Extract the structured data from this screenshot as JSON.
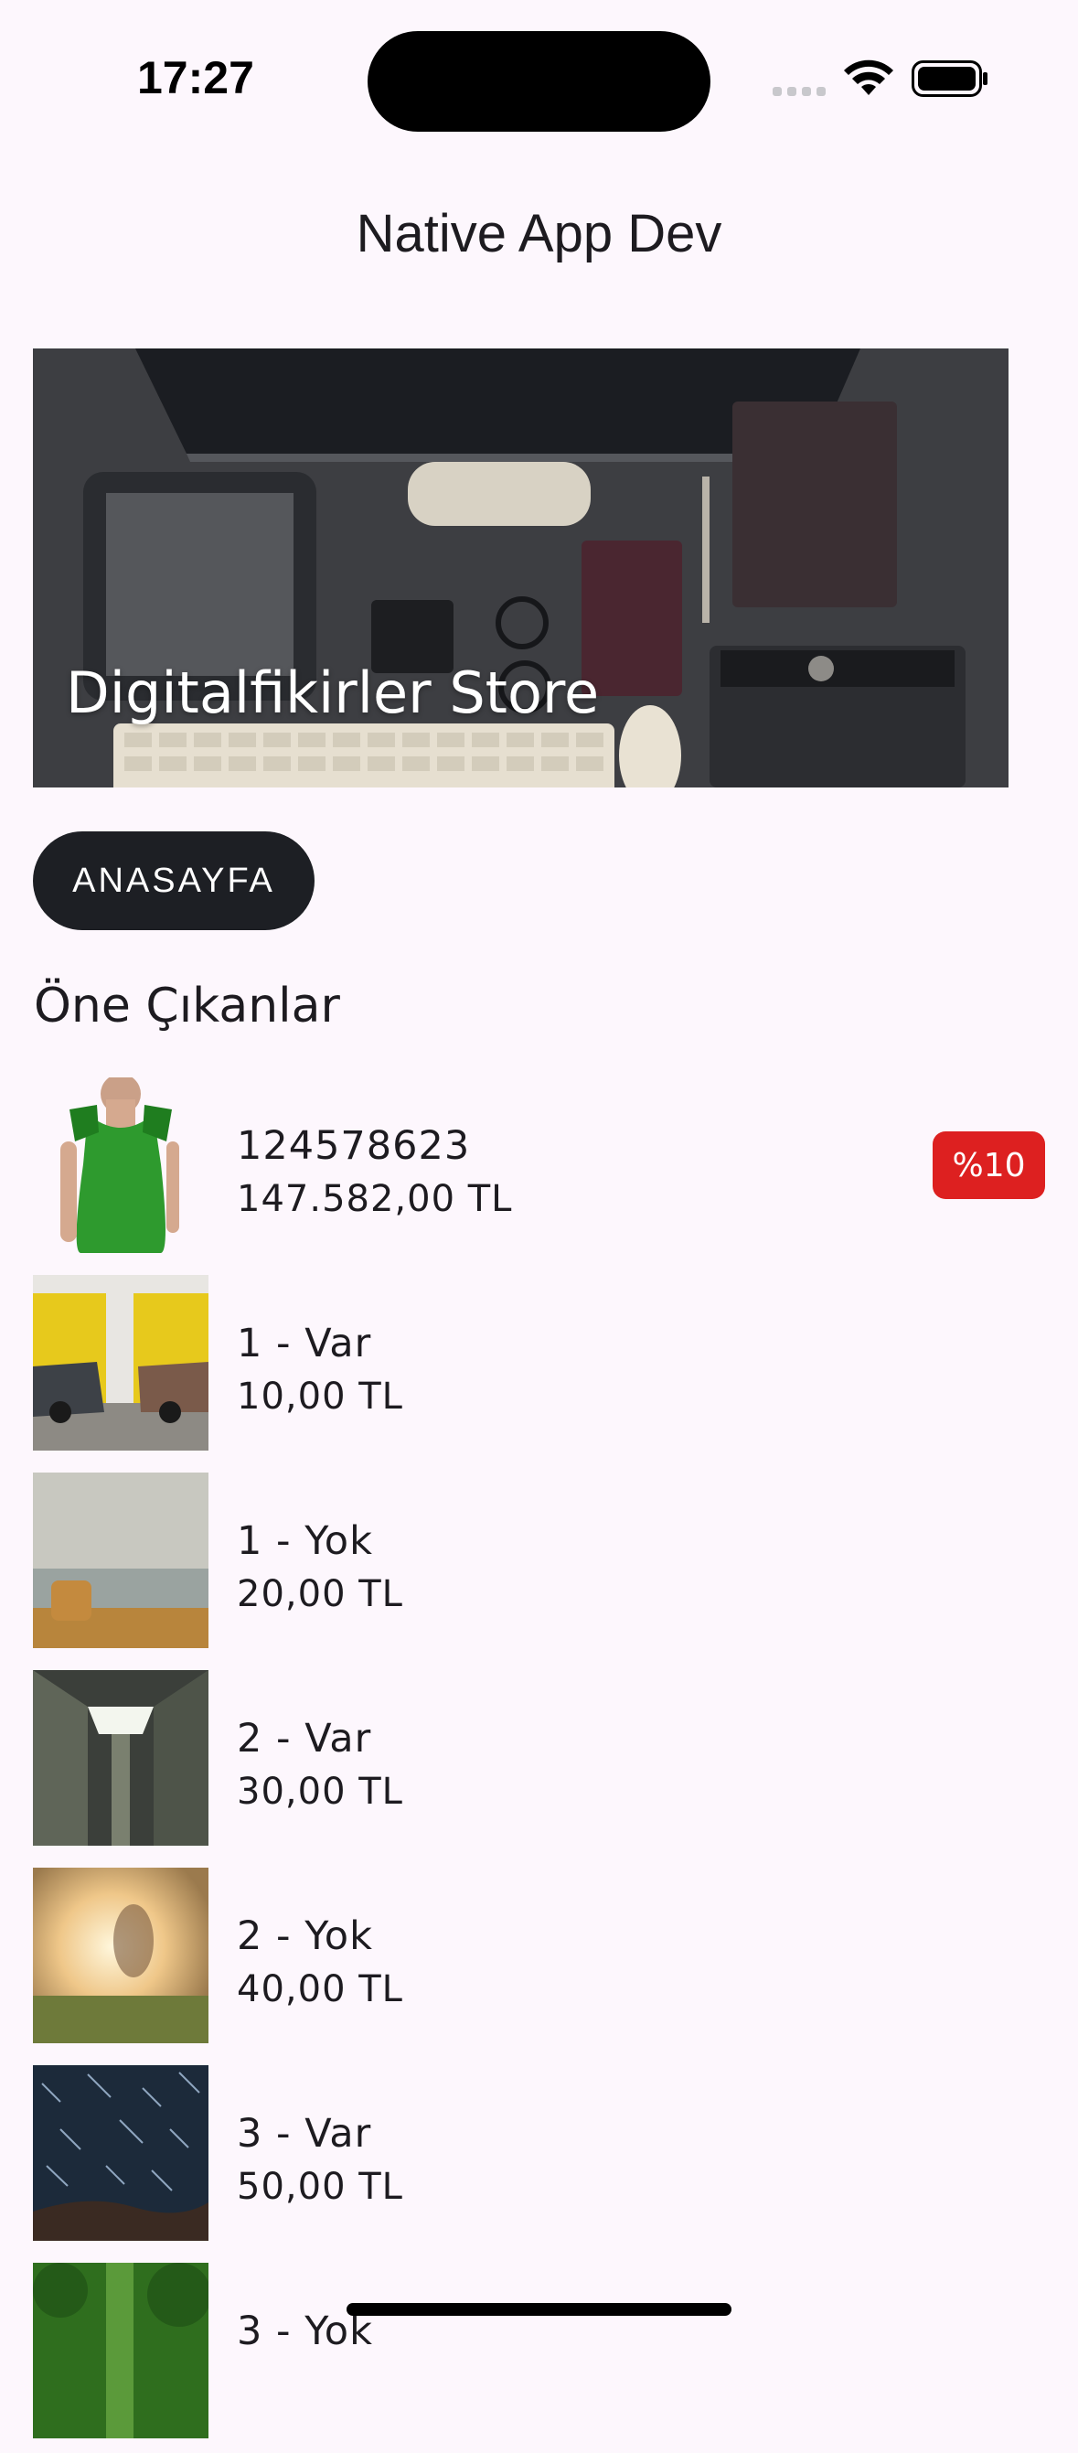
{
  "status_bar": {
    "time": "17:27"
  },
  "header": {
    "title": "Native App Dev"
  },
  "banner": {
    "caption": "Digitalfikirler Store"
  },
  "home_button": {
    "label": "ANASAYFA"
  },
  "section": {
    "title": "Öne Çıkanlar"
  },
  "products": [
    {
      "name": "124578623",
      "price": "147.582,00 TL",
      "badge": "%10",
      "thumb": "green-dress-photo"
    },
    {
      "name": "1 - Var",
      "price": "10,00 TL",
      "thumb": "vintage-cars-photo"
    },
    {
      "name": "1 - Yok",
      "price": "20,00 TL",
      "thumb": "hay-bale-field-photo"
    },
    {
      "name": "2 - Var",
      "price": "30,00 TL",
      "thumb": "building-courtyard-photo"
    },
    {
      "name": "2 - Yok",
      "price": "40,00 TL",
      "thumb": "sunset-meadow-photo"
    },
    {
      "name": "3 - Var",
      "price": "50,00 TL",
      "thumb": "star-trails-photo"
    },
    {
      "name": "3 - Yok",
      "price": "",
      "thumb": "forest-photo"
    }
  ],
  "colors": {
    "background": "#fdf7fd",
    "button": "#1d1f24",
    "badge": "#dd2020"
  }
}
